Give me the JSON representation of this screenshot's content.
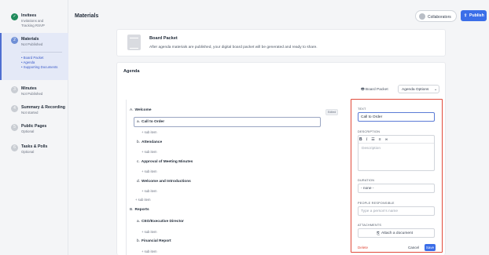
{
  "sidebar": {
    "steps": [
      {
        "title": "Invitees",
        "sub1": "Invitations and",
        "sub2": "Tracking RSVP",
        "marker": "check-icon"
      },
      {
        "title": "Materials",
        "sub1": "Not Published",
        "marker": "2",
        "subitems": [
          "Board Packet",
          "Agenda",
          "Supporting Documents"
        ]
      },
      {
        "title": "Minutes",
        "sub1": "Not Published",
        "marker": "3"
      },
      {
        "title": "Summary & Recording",
        "sub1": "Not started",
        "marker": "4"
      },
      {
        "title": "Public Pages",
        "sub1": "Optional",
        "marker": "5"
      },
      {
        "title": "Tasks & Polls",
        "sub1": "Optional",
        "marker": "6"
      }
    ]
  },
  "header": {
    "title": "Materials",
    "collaborators_label": "Collaborators",
    "publish_label": "Publish"
  },
  "board_packet": {
    "title": "Board Packet",
    "description": "After agenda materials are published, your digital board packet will be generated and ready to share."
  },
  "agenda": {
    "title": "Agenda",
    "board_packet_btn": "Board Packet",
    "options_btn": "Agenda Options",
    "edited_badge": "Edited",
    "add_sub_label": "+ sub item",
    "sections": [
      {
        "num": "A.",
        "title": "Welcome"
      },
      {
        "num": "B.",
        "title": "Reports"
      }
    ],
    "items": [
      {
        "num": "a.",
        "title": "Call to Order"
      },
      {
        "num": "b.",
        "title": "Attendance"
      },
      {
        "num": "c.",
        "title": "Approval of Meeting Minutes"
      },
      {
        "num": "d.",
        "title": "Welcome and Introductions"
      },
      {
        "num": "a.",
        "title": "CEO/Executive Director"
      },
      {
        "num": "b.",
        "title": "Financial Report"
      }
    ]
  },
  "editor": {
    "text_label": "TEXT",
    "text_value": "Call to Order",
    "description_label": "DESCRIPTION",
    "description_placeholder": "Description",
    "duration_label": "DURATION",
    "duration_value": "- none -",
    "people_label": "PEOPLE RESPONSIBLE",
    "people_placeholder": "Type a person's name",
    "attachments_label": "ATTACHMENTS",
    "attach_button": "Attach a document",
    "delete_label": "Delete",
    "cancel_label": "Cancel",
    "save_label": "Save",
    "highlight_color": "#e04a3a"
  }
}
